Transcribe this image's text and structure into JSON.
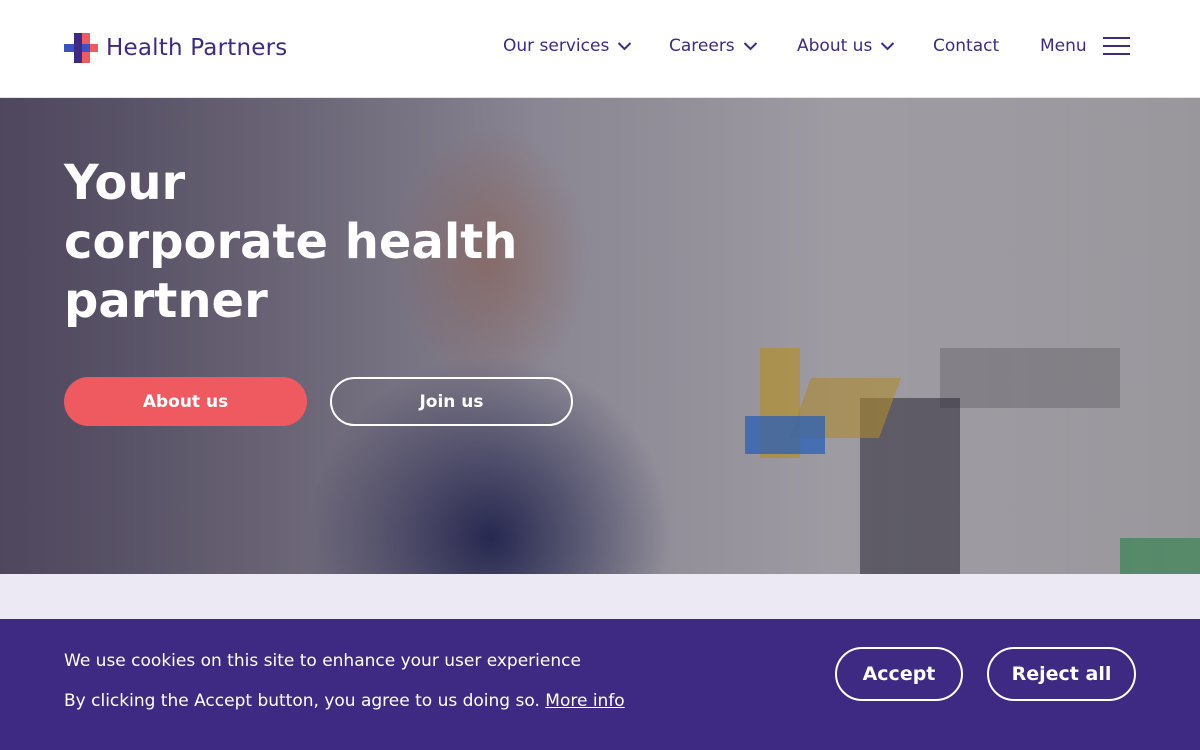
{
  "brand": {
    "name": "Health Partners",
    "colors": {
      "primary": "#3e2a83",
      "accent": "#ee5a5f",
      "logo_blue": "#3c52c4",
      "lavender": "#ece9f4"
    }
  },
  "nav": {
    "items": [
      {
        "label": "Our services",
        "has_dropdown": true
      },
      {
        "label": "Careers",
        "has_dropdown": true
      },
      {
        "label": "About us",
        "has_dropdown": true
      },
      {
        "label": "Contact",
        "has_dropdown": false
      }
    ],
    "menu_label": "Menu",
    "menu_icon": "hamburger-icon",
    "dropdown_icon": "chevron-down-icon"
  },
  "hero": {
    "title_lines": [
      "Your",
      "corporate health",
      "partner"
    ],
    "primary_button": "About us",
    "secondary_button": "Join us"
  },
  "cookie_banner": {
    "line1": "We use cookies on this site to enhance your user experience",
    "line2": "By clicking the Accept button, you agree to us doing so.",
    "more_info": "More info",
    "accept": "Accept",
    "reject": "Reject all"
  }
}
